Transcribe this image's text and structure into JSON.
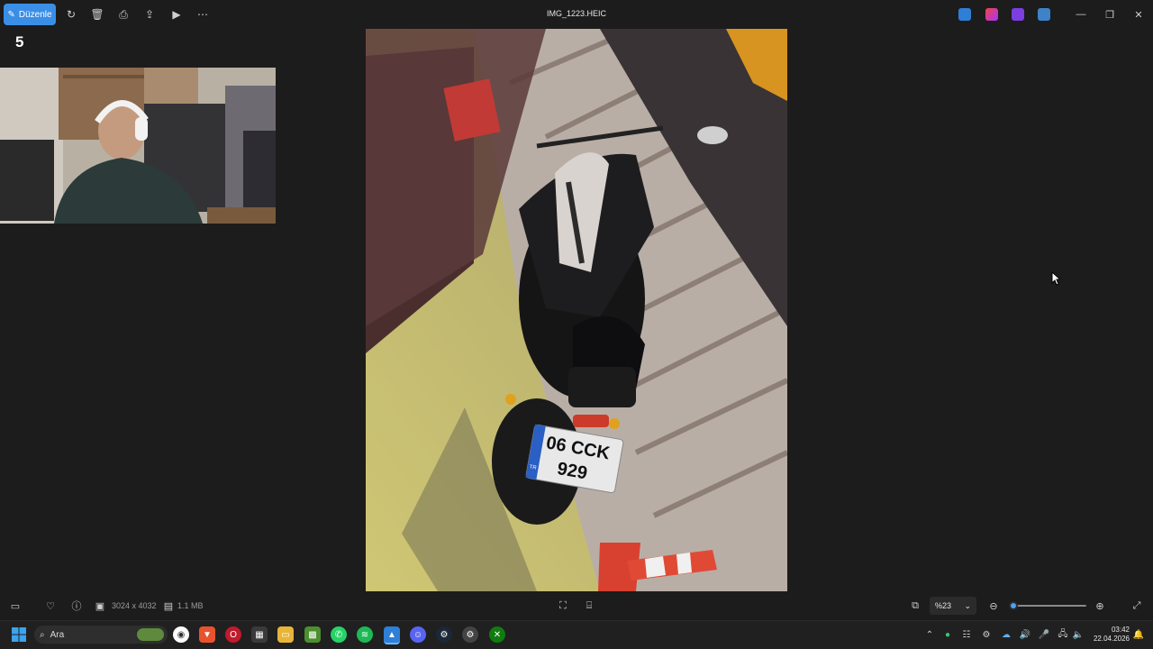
{
  "toolbar": {
    "edit_label": "Düzenle",
    "icons": [
      "rotate-icon",
      "delete-icon",
      "print-icon",
      "share-icon",
      "slideshow-icon",
      "more-icon"
    ],
    "accent": "#3a8ee6"
  },
  "window": {
    "title": "IMG_1223.HEIC"
  },
  "overlay": {
    "counter": "5"
  },
  "photo": {
    "plate_line1": "06 CCK",
    "plate_line2": "929",
    "plate_country": "TR"
  },
  "info": {
    "dimensions": "3024 x 4032",
    "size": "1.1 MB"
  },
  "zoom": {
    "value_label": "%23",
    "level": 0.04
  },
  "taskbar": {
    "search_label": "Ara",
    "clock_time": "03:42",
    "clock_date": "22.04.2026"
  }
}
